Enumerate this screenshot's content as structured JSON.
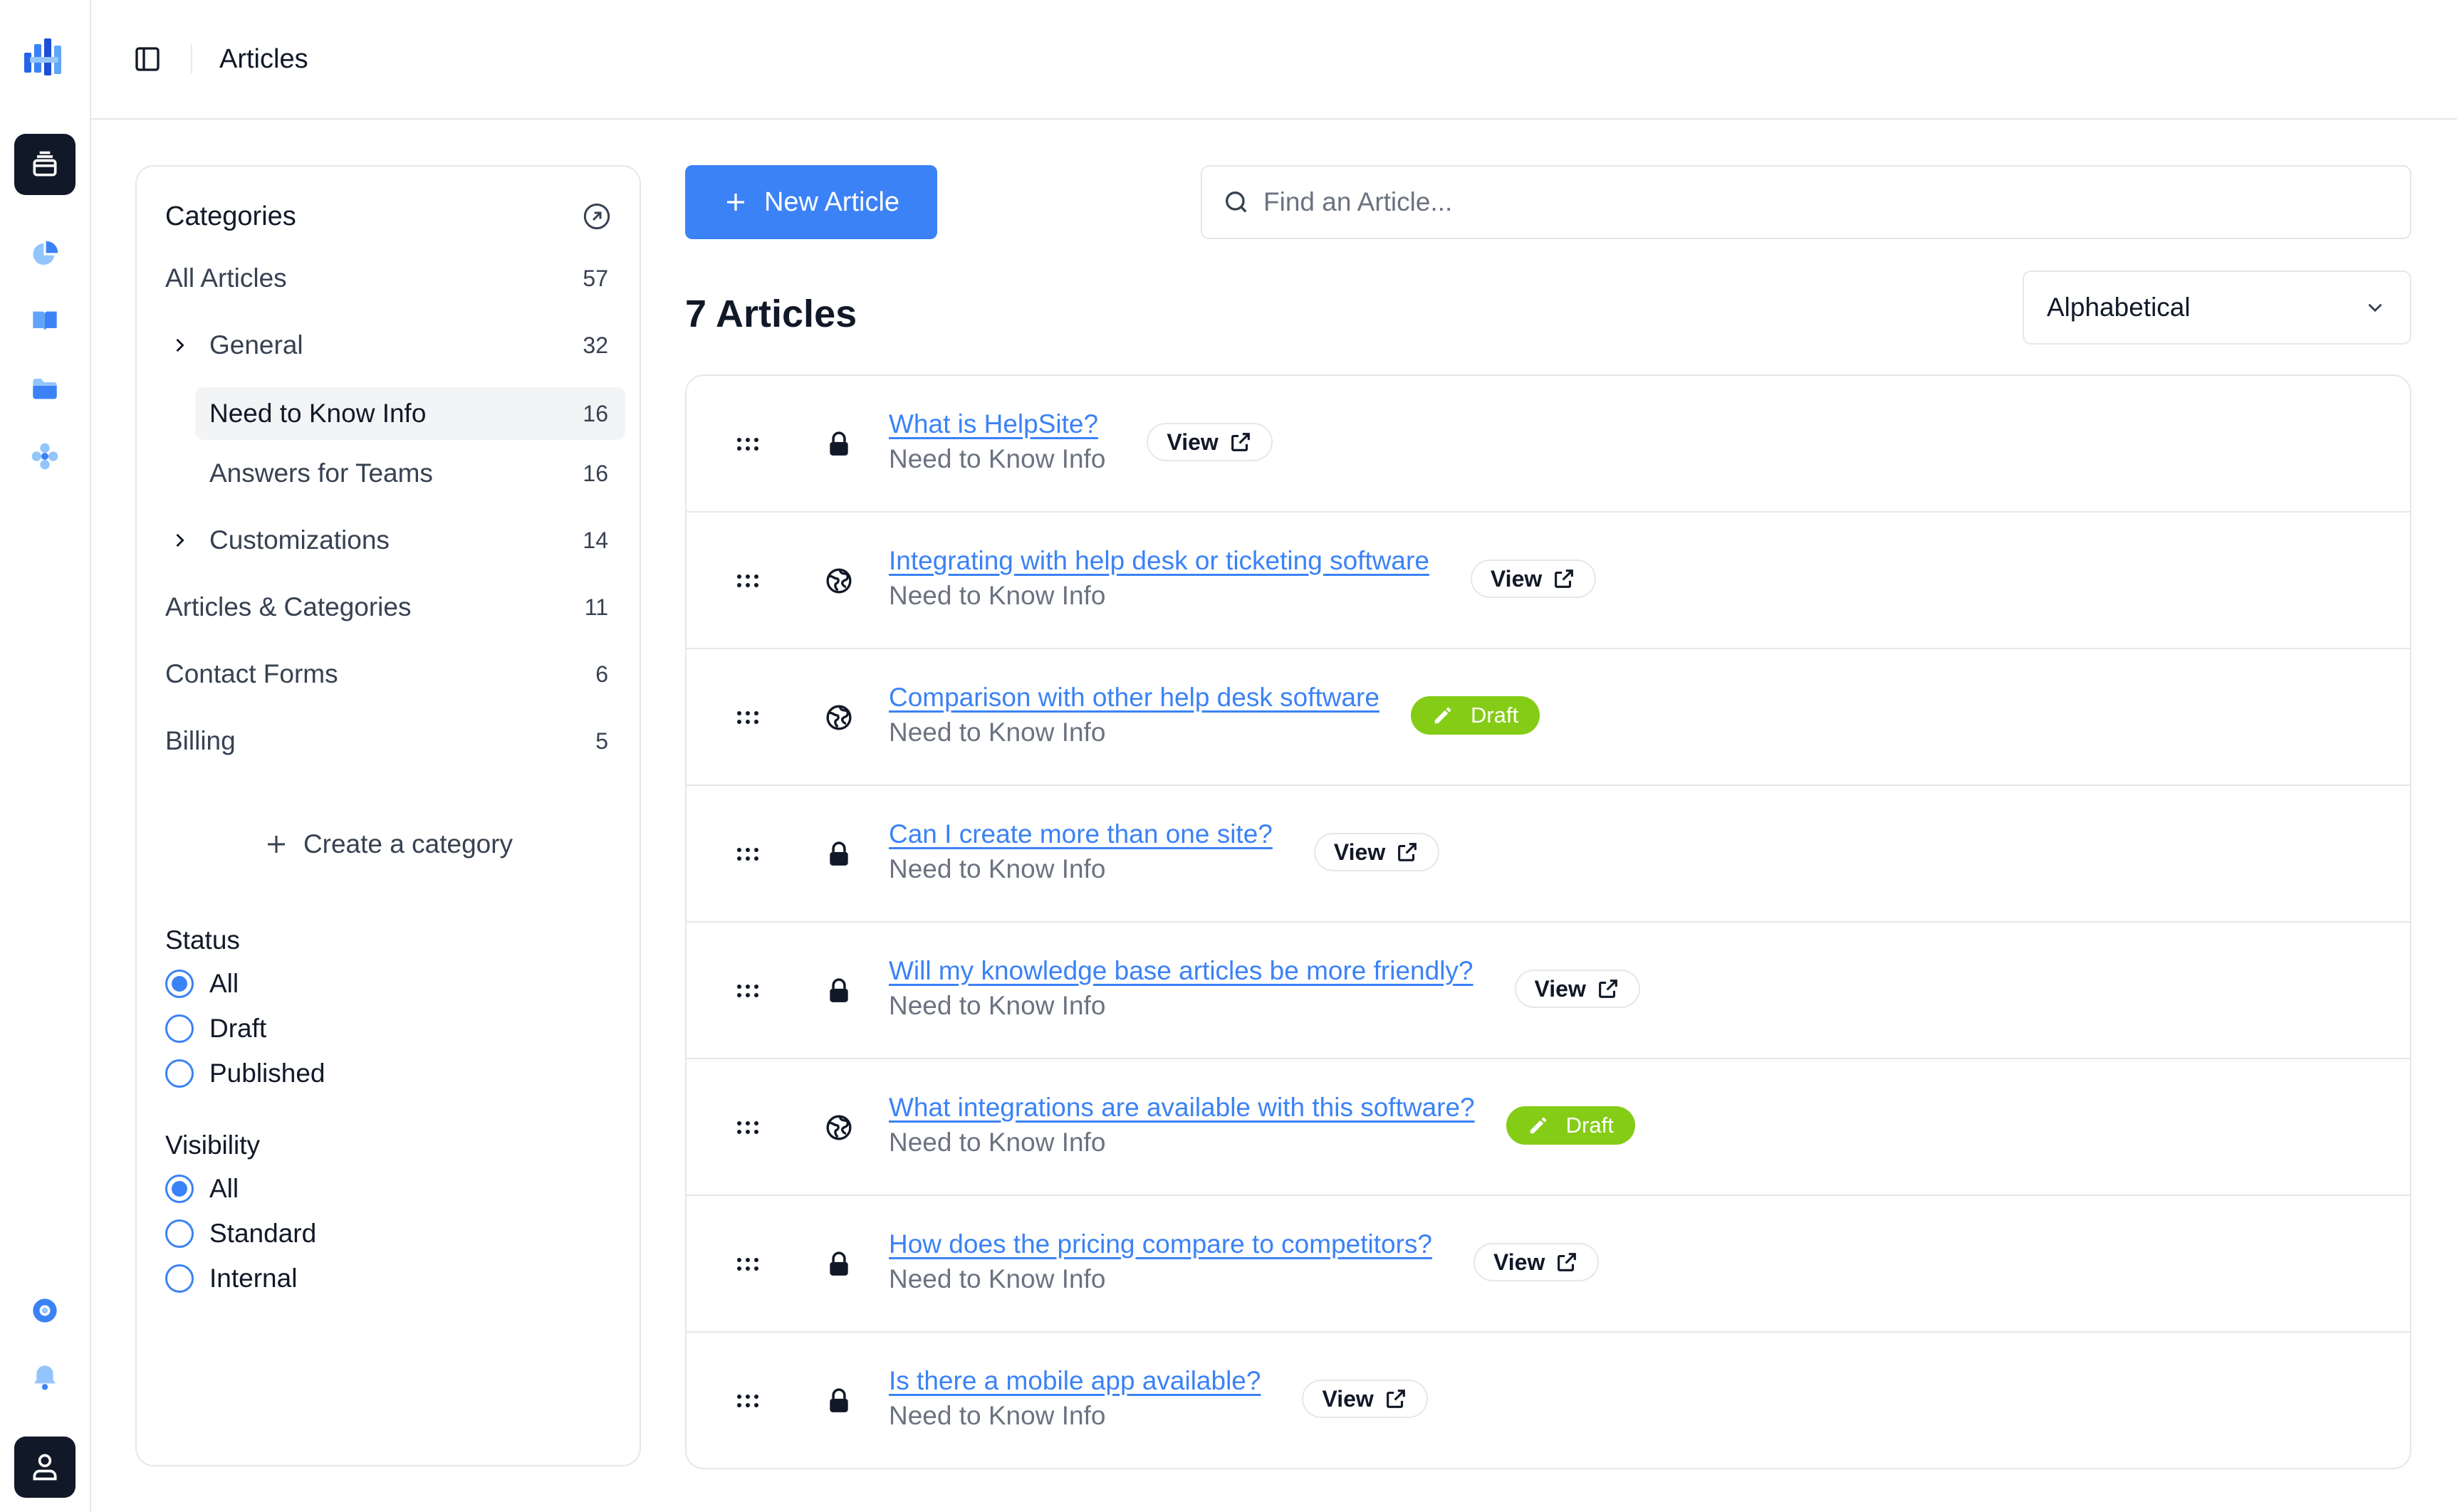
{
  "header": {
    "title": "Articles"
  },
  "sidebar": {
    "categories_label": "Categories",
    "categories": [
      {
        "label": "All Articles",
        "count": "57"
      },
      {
        "label": "General",
        "count": "32"
      },
      {
        "label": "Need to Know Info",
        "count": "16"
      },
      {
        "label": "Answers for Teams",
        "count": "16"
      },
      {
        "label": "Customizations",
        "count": "14"
      },
      {
        "label": "Articles & Categories",
        "count": "11"
      },
      {
        "label": "Contact Forms",
        "count": "6"
      },
      {
        "label": "Billing",
        "count": "5"
      }
    ],
    "create_category": "Create a category",
    "status": {
      "title": "Status",
      "options": [
        "All",
        "Draft",
        "Published"
      ],
      "selected": "All"
    },
    "visibility": {
      "title": "Visibility",
      "options": [
        "All",
        "Standard",
        "Internal"
      ],
      "selected": "All"
    }
  },
  "toolbar": {
    "new_article": "New Article",
    "search_placeholder": "Find an Article...",
    "count_title": "7 Articles",
    "sort_value": "Alphabetical"
  },
  "articles": [
    {
      "title": "What is HelpSite?",
      "category": "Need to Know Info",
      "visibility": "lock-icon",
      "badge": "View"
    },
    {
      "title": "Integrating with help desk or ticketing software",
      "category": "Need to Know Info",
      "visibility": "globe-icon",
      "badge": "View"
    },
    {
      "title": "Comparison with other help desk software",
      "category": "Need to Know Info",
      "visibility": "globe-icon",
      "badge": "Draft"
    },
    {
      "title": "Can I create more than one site?",
      "category": "Need to Know Info",
      "visibility": "lock-icon",
      "badge": "View"
    },
    {
      "title": "Will my knowledge base articles be more friendly?",
      "category": "Need to Know Info",
      "visibility": "lock-icon",
      "badge": "View"
    },
    {
      "title": "What integrations are available with this software?",
      "category": "Need to Know Info",
      "visibility": "globe-icon",
      "badge": "Draft"
    },
    {
      "title": "How does the pricing compare to competitors?",
      "category": "Need to Know Info",
      "visibility": "lock-icon",
      "badge": "View"
    },
    {
      "title": "Is there a mobile app available?",
      "category": "Need to Know Info",
      "visibility": "lock-icon",
      "badge": "View"
    }
  ],
  "colors": {
    "accent": "#3b82f6",
    "draft": "#84cc16",
    "dark": "#111827"
  }
}
